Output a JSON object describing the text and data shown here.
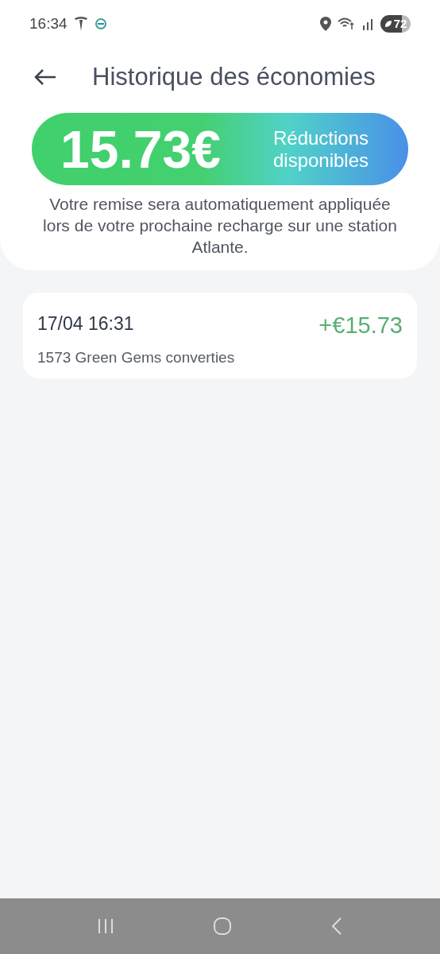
{
  "status_bar": {
    "time": "16:34",
    "battery": "72"
  },
  "header": {
    "title": "Historique des économies"
  },
  "balance": {
    "amount": "15.73€",
    "label": "Réductions disponibles",
    "note": "Votre remise sera automatiquement appliquée lors de votre prochaine recharge sur une station Atlante."
  },
  "history": [
    {
      "date": "17/04 16:31",
      "amount": "+€15.73",
      "description": "1573 Green Gems converties"
    }
  ]
}
